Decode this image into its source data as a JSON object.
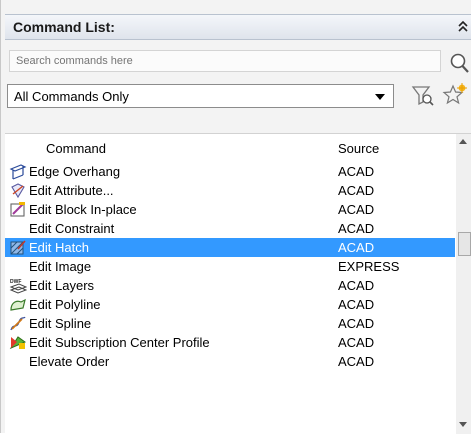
{
  "panel": {
    "title": "Command List:",
    "search": {
      "placeholder": "Search commands here"
    },
    "filter": {
      "selected": "All Commands Only"
    }
  },
  "list": {
    "columns": {
      "command": "Command",
      "source": "Source"
    },
    "rows": [
      {
        "name": "Edge Overhang",
        "source": "ACAD",
        "icon": "edge-overhang-icon"
      },
      {
        "name": "Edit Attribute...",
        "source": "ACAD",
        "icon": "edit-attribute-icon"
      },
      {
        "name": "Edit Block In-place",
        "source": "ACAD",
        "icon": "edit-block-icon"
      },
      {
        "name": "Edit Constraint",
        "source": "ACAD",
        "icon": ""
      },
      {
        "name": "Edit Hatch",
        "source": "ACAD",
        "icon": "edit-hatch-icon",
        "selected": true
      },
      {
        "name": "Edit Image",
        "source": "EXPRESS",
        "icon": ""
      },
      {
        "name": "Edit Layers",
        "source": "ACAD",
        "icon": "dwf-layers-icon"
      },
      {
        "name": "Edit Polyline",
        "source": "ACAD",
        "icon": "edit-polyline-icon"
      },
      {
        "name": "Edit Spline",
        "source": "ACAD",
        "icon": "edit-spline-icon"
      },
      {
        "name": "Edit Subscription Center Profile",
        "source": "ACAD",
        "icon": "subscription-profile-icon"
      },
      {
        "name": "Elevate Order",
        "source": "ACAD",
        "icon": ""
      }
    ]
  },
  "colors": {
    "selection": "#3399ff",
    "header_bg": "#dfe4ec"
  }
}
